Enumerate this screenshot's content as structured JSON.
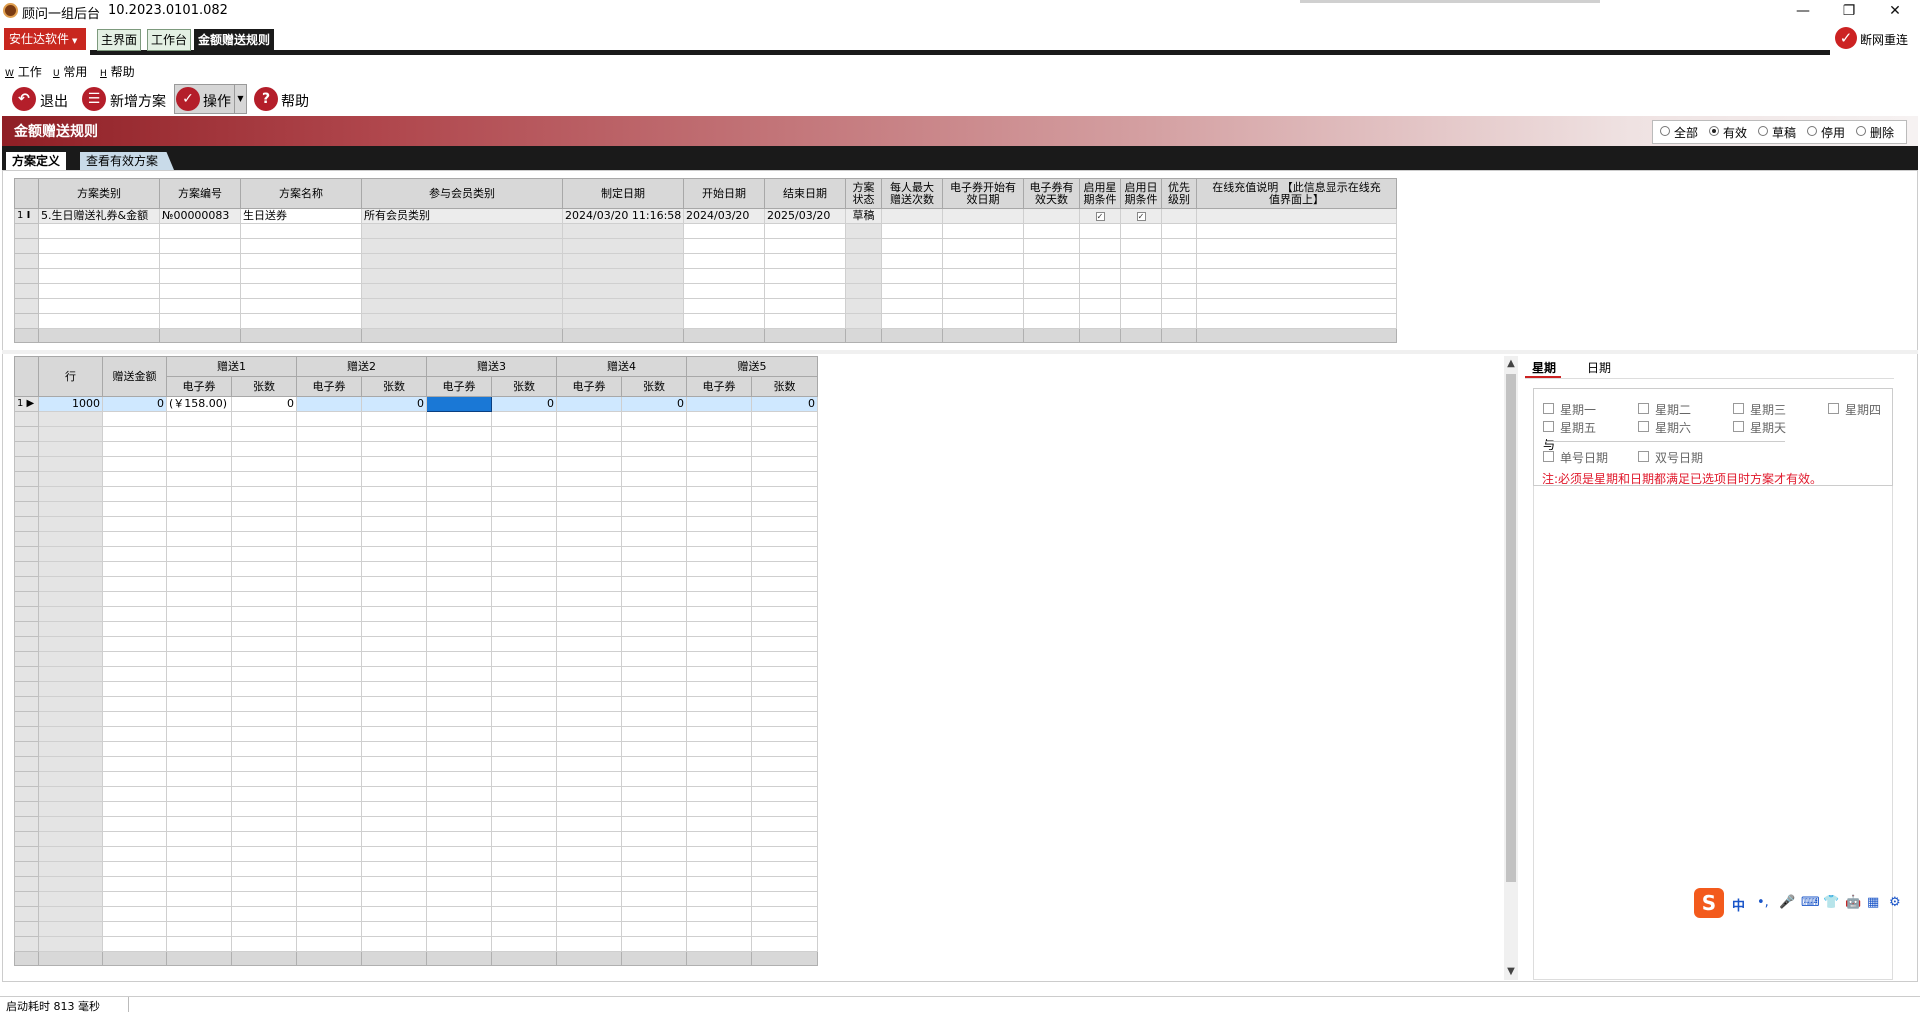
{
  "window": {
    "title": "顾问一组后台",
    "version": "10.2023.0101.082",
    "controls": {
      "minimize": "—",
      "restore": "❐",
      "close": "✕"
    }
  },
  "brand_menu": "安仕达软件",
  "top_tabs": [
    "主界面",
    "工作台",
    "金额赠送规则"
  ],
  "reconnect_label": "断网重连",
  "menubar": [
    {
      "key": "W",
      "label": "工作"
    },
    {
      "key": "U",
      "label": "常用"
    },
    {
      "key": "H",
      "label": "帮助"
    }
  ],
  "toolbar": {
    "exit": "退出",
    "new_plan": "新增方案",
    "operate": "操作",
    "help": "帮助"
  },
  "banner_title": "金额赠送规则",
  "status_filter": {
    "options": [
      "全部",
      "有效",
      "草稿",
      "停用",
      "删除"
    ],
    "selected": "有效"
  },
  "sub_tabs": [
    "方案定义",
    "查看有效方案"
  ],
  "plan_grid": {
    "headers": [
      "方案类别",
      "方案编号",
      "方案名称",
      "参与会员类别",
      "制定日期",
      "开始日期",
      "结束日期",
      "方案\n状态",
      "每人最大\n赠送次数",
      "电子券开始有\n效日期",
      "电子券有\n效天数",
      "启用星\n期条件",
      "启用日\n期条件",
      "优先\n级别",
      "在线充值说明 【此信息显示在线充\n值界面上】"
    ],
    "rows": [
      {
        "index": "1",
        "category": "5.生日赠送礼券&金额",
        "code": "№00000083",
        "name": "生日送券",
        "member_type": "所有会员类别",
        "created": "2024/03/20 11:16:58",
        "start": "2024/03/20",
        "end": "2025/03/20",
        "status": "草稿",
        "max_times": "",
        "coupon_start": "",
        "coupon_days": "",
        "week_cond": "✓",
        "date_cond": "✓",
        "priority": "",
        "note": ""
      }
    ]
  },
  "gift_grid": {
    "headers": {
      "row": "行",
      "amount": "赠送金额",
      "groups": [
        "赠送1",
        "赠送2",
        "赠送3",
        "赠送4",
        "赠送5"
      ],
      "sub": [
        "电子券",
        "张数"
      ]
    },
    "rows": [
      {
        "index": "1",
        "row": "1000",
        "amount": "0",
        "g1_coupon": "(￥158.00)",
        "g1_qty": "0",
        "g2_coupon": "",
        "g2_qty": "0",
        "g3_coupon": "",
        "g3_qty": "0",
        "g4_coupon": "",
        "g4_qty": "0",
        "g5_coupon": "",
        "g5_qty": "0"
      }
    ]
  },
  "right_panel": {
    "tabs": [
      "星期",
      "日期"
    ],
    "weekdays": [
      "星期一",
      "星期二",
      "星期三",
      "星期四",
      "星期五",
      "星期六",
      "星期天"
    ],
    "with_label": "与",
    "odd_date": "单号日期",
    "even_date": "双号日期",
    "note": "注:必须是星期和日期都满足已选项目时方案才有效。"
  },
  "ime": {
    "logo": "S",
    "items": [
      "中",
      "•,",
      "🎤",
      "⌨",
      "👕",
      "🤖",
      "▦",
      "⚙"
    ]
  },
  "statusbar": "启动耗时 813 毫秒",
  "colors": {
    "banner": "#8f1f25",
    "brand": "#c8271f",
    "note": "#e0182b",
    "selected_cell": "#1a78d6",
    "row_highlight": "#cfe8ff"
  }
}
